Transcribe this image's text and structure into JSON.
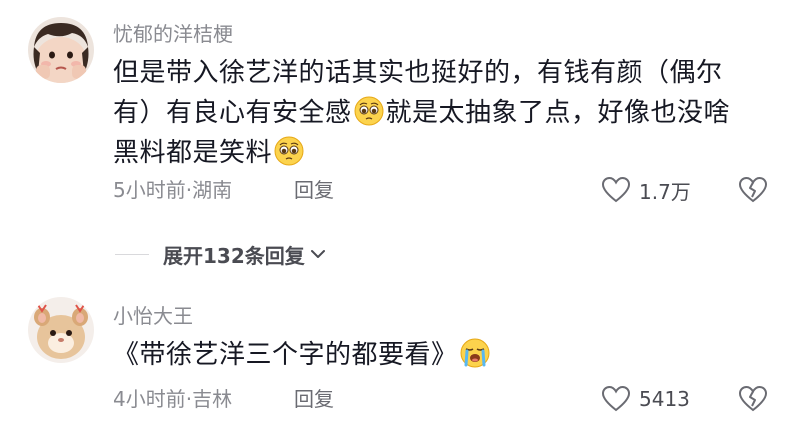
{
  "comments": [
    {
      "username": "忧郁的洋桔梗",
      "text_line1": "但是带入徐艺洋的话其实也挺好的，有钱有颜（偶尔",
      "text_line2a": "有）有良心有安全感",
      "text_line2b": "就是太抽象了点，好像也没啥",
      "text_line3": "黑料都是笑料",
      "meta": "5小时前·湖南",
      "reply_label": "回复",
      "like_count": "1.7万"
    },
    {
      "username": "小怡大王",
      "text_a": "《带徐艺洋三个字的都要看》",
      "meta": "4小时前·吉林",
      "reply_label": "回复",
      "like_count": "5413"
    }
  ],
  "expand_replies": {
    "label": "展开132条回复"
  },
  "icons": {
    "heart": "heart-outline-icon",
    "dislike": "broken-heart-icon",
    "chevron": "chevron-down-icon",
    "emoji_pleading": "pleading-face-emoji",
    "emoji_crying": "loudly-crying-face-emoji"
  }
}
